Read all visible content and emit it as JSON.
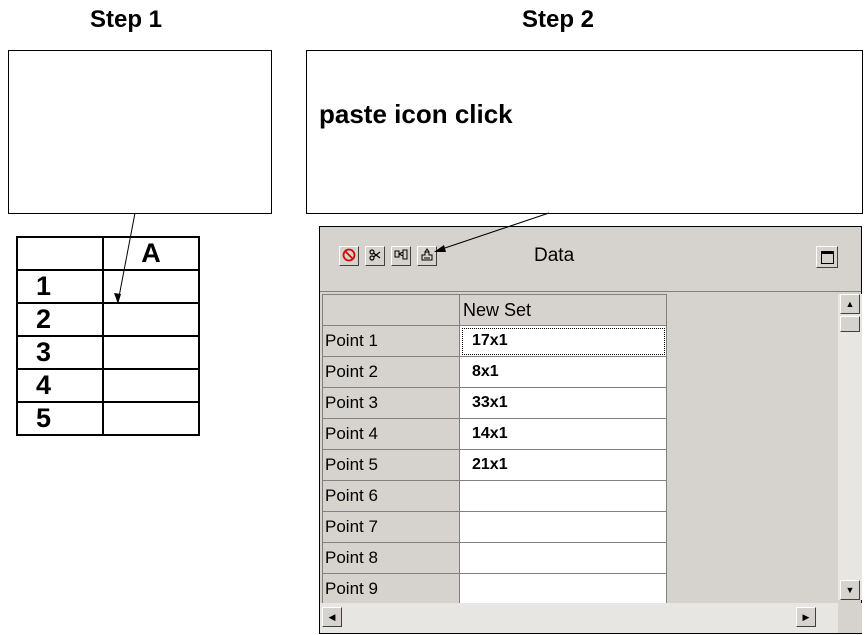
{
  "step1": {
    "title": "Step 1",
    "grid": {
      "column_header": "A",
      "row_headers": [
        "1",
        "2",
        "3",
        "4",
        "5"
      ]
    }
  },
  "step2": {
    "title": "Step 2",
    "instruction": "paste icon click"
  },
  "data_window": {
    "title": "Data",
    "toolbar_icons": [
      "stop-icon",
      "cut-icon",
      "copy-icon",
      "paste-icon"
    ],
    "column_header": "New Set",
    "rows": [
      {
        "label": "Point 1",
        "value": "17x1"
      },
      {
        "label": "Point 2",
        "value": "8x1"
      },
      {
        "label": "Point 3",
        "value": "33x1"
      },
      {
        "label": "Point 4",
        "value": "14x1"
      },
      {
        "label": "Point 5",
        "value": "21x1"
      },
      {
        "label": "Point 6",
        "value": ""
      },
      {
        "label": "Point 7",
        "value": ""
      },
      {
        "label": "Point 8",
        "value": ""
      },
      {
        "label": "Point 9",
        "value": ""
      }
    ]
  },
  "colors": {
    "window_gray": "#d6d3ce",
    "stop_red": "#e00000"
  }
}
